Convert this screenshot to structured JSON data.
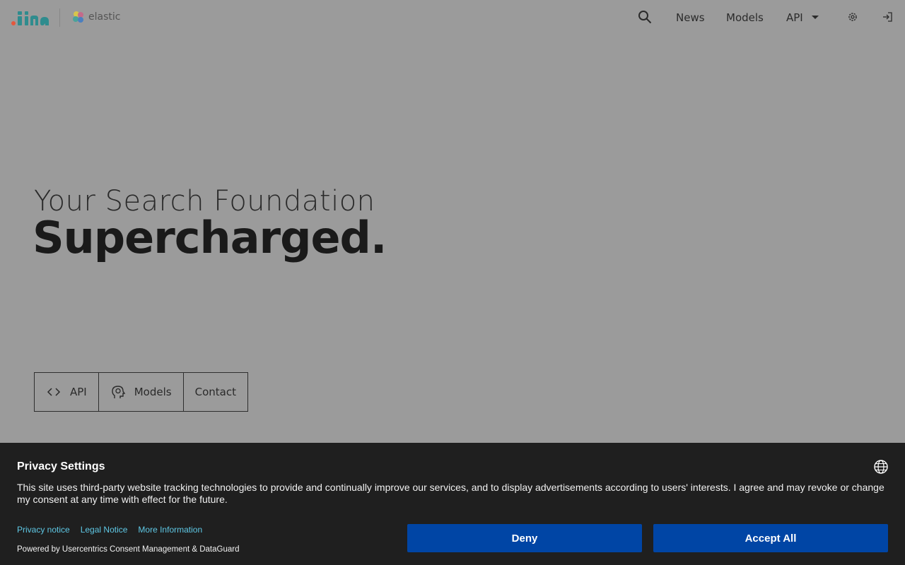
{
  "header": {
    "brand_secondary": "elastic",
    "nav": {
      "news": "News",
      "models": "Models",
      "api": "API"
    }
  },
  "hero": {
    "headline": "Your Search Foundation",
    "subheadline": "Supercharged.",
    "buttons": {
      "api": "API",
      "models": "Models",
      "contact": "Contact"
    }
  },
  "privacy": {
    "title": "Privacy Settings",
    "body": "This site uses third-party website tracking technologies to provide and continually improve our services, and to display advertisements according to users' interests. I agree and may revoke or change my consent at any time with effect for the future.",
    "links": {
      "privacy_notice": "Privacy notice",
      "legal_notice": "Legal Notice",
      "more_information": "More Information"
    },
    "powered_by": "Powered by Usercentrics Consent Management & DataGuard",
    "deny_label": "Deny",
    "accept_label": "Accept All"
  },
  "colors": {
    "overlay_background": "#9b9b9b",
    "banner_background": "#1f1f1f",
    "button_blue": "#0045a5",
    "link_cyan": "#5fc9e6"
  },
  "icons": {
    "search": "search-icon",
    "gear": "gear-icon",
    "login": "login-icon",
    "globe": "globe-icon",
    "code": "code-icon",
    "brain": "brain-head-icon",
    "caret": "chevron-down-icon"
  }
}
